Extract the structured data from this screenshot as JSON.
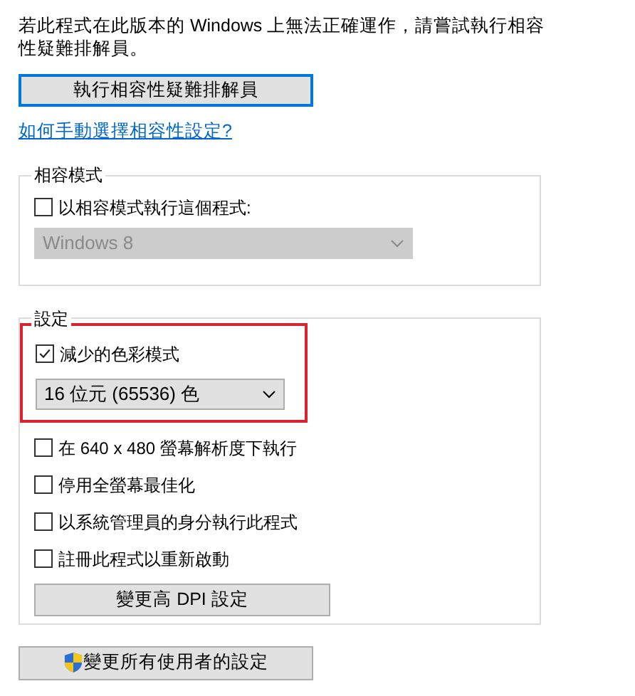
{
  "intro": "若此程式在此版本的 Windows 上無法正確運作，請嘗試執行相容性疑難排解員。",
  "troubleshoot_button": {
    "label": "執行相容性疑難排解員",
    "focused": true
  },
  "help_link": "如何手動選擇相容性設定?",
  "compatibility_mode": {
    "title": "相容模式",
    "checkbox": {
      "label": "以相容模式執行這個程式:",
      "checked": false
    },
    "dropdown": {
      "value": "Windows 8",
      "disabled": true
    }
  },
  "settings": {
    "title": "設定",
    "highlighted": true,
    "items": [
      {
        "kind": "checkbox",
        "label": "減少的色彩模式",
        "checked": true
      },
      {
        "kind": "dropdown",
        "value": "16 位元 (65536) 色",
        "disabled": false
      },
      {
        "kind": "checkbox",
        "label": "在 640 x 480 螢幕解析度下執行",
        "checked": false
      },
      {
        "kind": "checkbox",
        "label": "停用全螢幕最佳化",
        "checked": false
      },
      {
        "kind": "checkbox",
        "label": "以系統管理員的身分執行此程式",
        "checked": false
      },
      {
        "kind": "checkbox",
        "label": "註冊此程式以重新啟動",
        "checked": false
      },
      {
        "kind": "button",
        "label": "變更高 DPI 設定"
      }
    ]
  },
  "all_users_button": {
    "label": "變更所有使用者的設定"
  }
}
